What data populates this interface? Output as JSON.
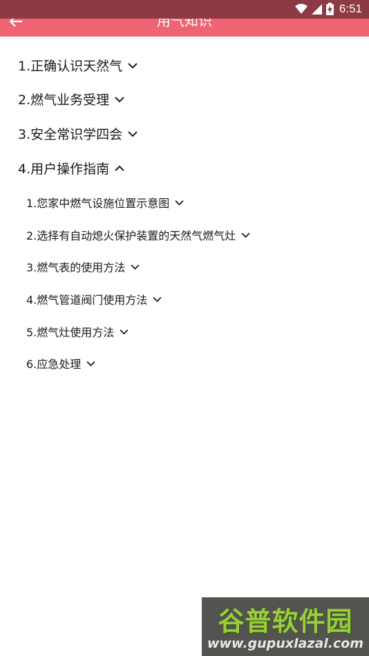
{
  "status_bar": {
    "time": "6:51",
    "icons": [
      "wifi-icon",
      "cell-signal-icon",
      "battery-charging-icon"
    ]
  },
  "app_bar": {
    "title": "用气知识",
    "back_icon": "arrow-left-icon",
    "background_color": "#ee6473"
  },
  "menu": {
    "items": [
      {
        "label": "1.正确认识天然气",
        "level": 1,
        "expanded": false
      },
      {
        "label": "2.燃气业务受理",
        "level": 1,
        "expanded": false
      },
      {
        "label": "3.安全常识学四会",
        "level": 1,
        "expanded": false
      },
      {
        "label": "4.用户操作指南",
        "level": 1,
        "expanded": true
      },
      {
        "label": "1.您家中燃气设施位置示意图",
        "level": 2,
        "expanded": false
      },
      {
        "label": "2.选择有自动熄火保护装置的天然气燃气灶",
        "level": 2,
        "expanded": false
      },
      {
        "label": "3.燃气表的使用方法",
        "level": 2,
        "expanded": false
      },
      {
        "label": "4.燃气管道阀门使用方法",
        "level": 2,
        "expanded": false
      },
      {
        "label": "5.燃气灶使用方法",
        "level": 2,
        "expanded": false
      },
      {
        "label": "6.应急处理",
        "level": 2,
        "expanded": false
      }
    ]
  },
  "watermark": {
    "title": "谷普软件园",
    "url": "www.gupuxlazal.com"
  }
}
